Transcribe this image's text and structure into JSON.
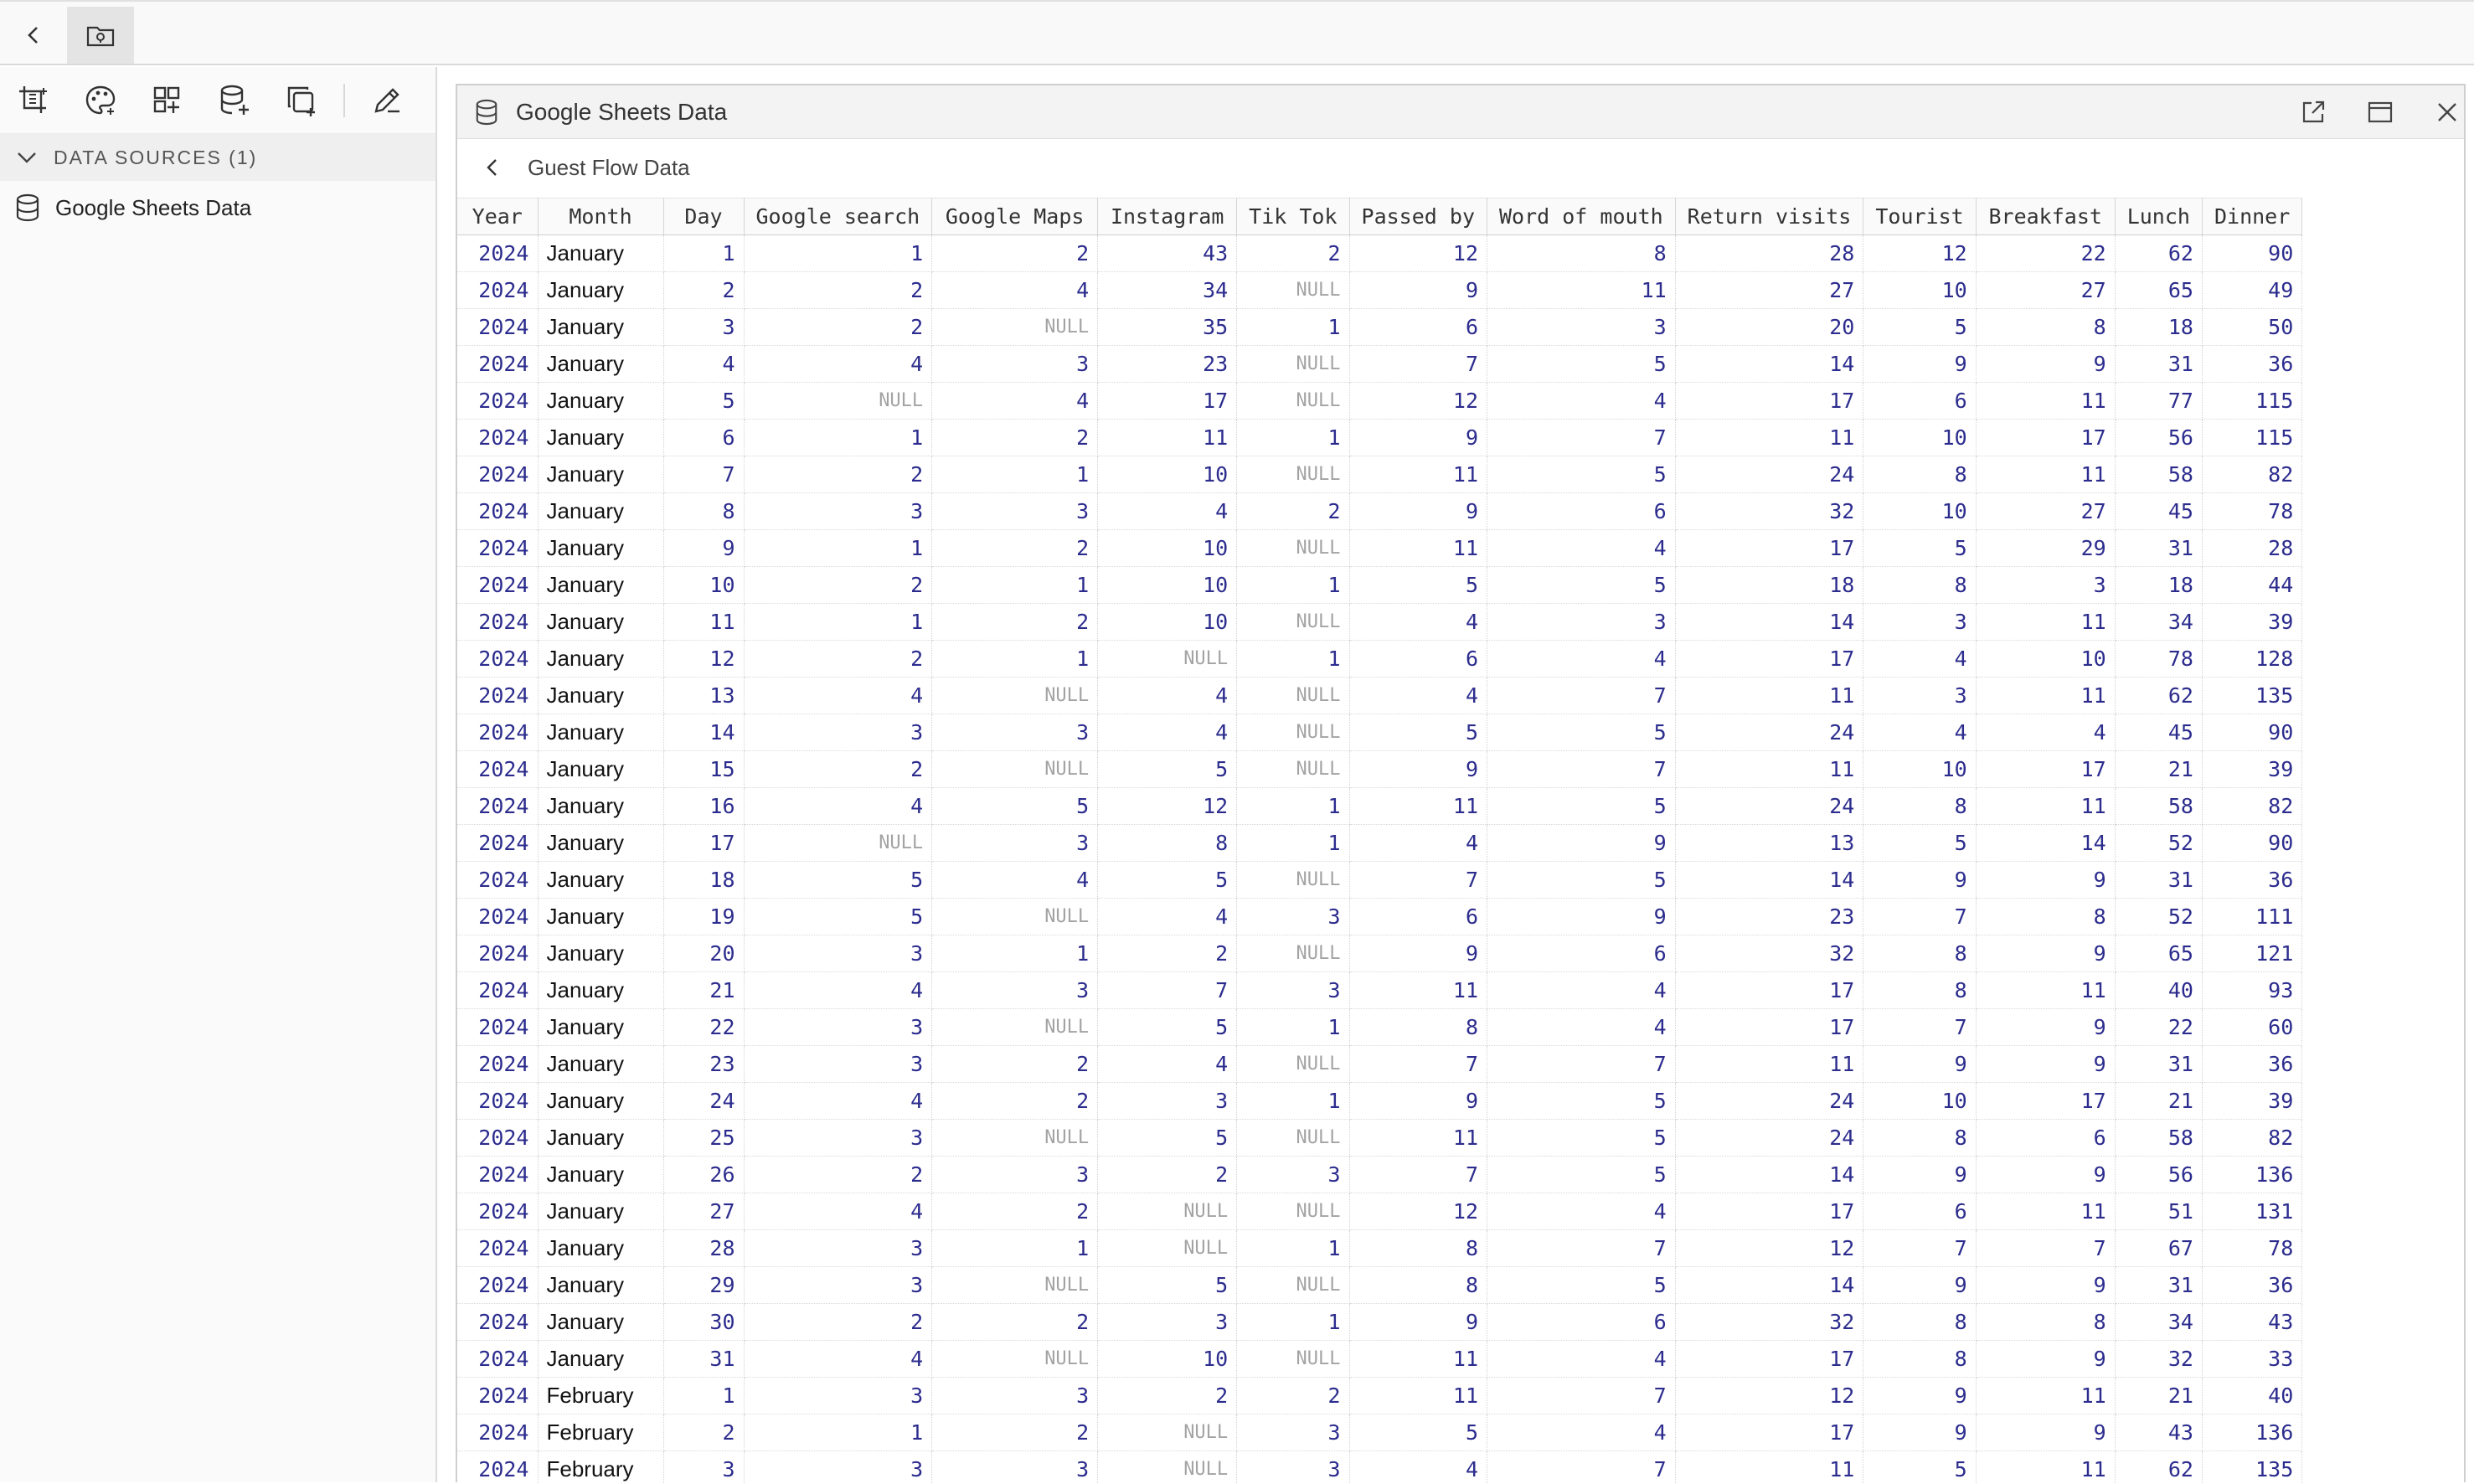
{
  "window": {
    "title": "Google Sheets Data",
    "breadcrumb": "Guest Flow Data"
  },
  "sidebar": {
    "section_title": "DATA SOURCES (1)",
    "items": [
      {
        "label": "Google Sheets Data",
        "icon": "database-icon"
      }
    ]
  },
  "table": {
    "columns": [
      "Year",
      "Month",
      "Day",
      "Google search",
      "Google Maps",
      "Instagram",
      "Tik Tok",
      "Passed by",
      "Word of mouth",
      "Return visits",
      "Tourist",
      "Breakfast",
      "Lunch",
      "Dinner"
    ],
    "null_text": "NULL",
    "rows": [
      [
        "2024",
        "January",
        "1",
        "1",
        "2",
        "43",
        "2",
        "12",
        "8",
        "28",
        "12",
        "22",
        "62",
        "90"
      ],
      [
        "2024",
        "January",
        "2",
        "2",
        "4",
        "34",
        "NULL",
        "9",
        "11",
        "27",
        "10",
        "27",
        "65",
        "49"
      ],
      [
        "2024",
        "January",
        "3",
        "2",
        "NULL",
        "35",
        "1",
        "6",
        "3",
        "20",
        "5",
        "8",
        "18",
        "50"
      ],
      [
        "2024",
        "January",
        "4",
        "4",
        "3",
        "23",
        "NULL",
        "7",
        "5",
        "14",
        "9",
        "9",
        "31",
        "36"
      ],
      [
        "2024",
        "January",
        "5",
        "NULL",
        "4",
        "17",
        "NULL",
        "12",
        "4",
        "17",
        "6",
        "11",
        "77",
        "115"
      ],
      [
        "2024",
        "January",
        "6",
        "1",
        "2",
        "11",
        "1",
        "9",
        "7",
        "11",
        "10",
        "17",
        "56",
        "115"
      ],
      [
        "2024",
        "January",
        "7",
        "2",
        "1",
        "10",
        "NULL",
        "11",
        "5",
        "24",
        "8",
        "11",
        "58",
        "82"
      ],
      [
        "2024",
        "January",
        "8",
        "3",
        "3",
        "4",
        "2",
        "9",
        "6",
        "32",
        "10",
        "27",
        "45",
        "78"
      ],
      [
        "2024",
        "January",
        "9",
        "1",
        "2",
        "10",
        "NULL",
        "11",
        "4",
        "17",
        "5",
        "29",
        "31",
        "28"
      ],
      [
        "2024",
        "January",
        "10",
        "2",
        "1",
        "10",
        "1",
        "5",
        "5",
        "18",
        "8",
        "3",
        "18",
        "44"
      ],
      [
        "2024",
        "January",
        "11",
        "1",
        "2",
        "10",
        "NULL",
        "4",
        "3",
        "14",
        "3",
        "11",
        "34",
        "39"
      ],
      [
        "2024",
        "January",
        "12",
        "2",
        "1",
        "NULL",
        "1",
        "6",
        "4",
        "17",
        "4",
        "10",
        "78",
        "128"
      ],
      [
        "2024",
        "January",
        "13",
        "4",
        "NULL",
        "4",
        "NULL",
        "4",
        "7",
        "11",
        "3",
        "11",
        "62",
        "135"
      ],
      [
        "2024",
        "January",
        "14",
        "3",
        "3",
        "4",
        "NULL",
        "5",
        "5",
        "24",
        "4",
        "4",
        "45",
        "90"
      ],
      [
        "2024",
        "January",
        "15",
        "2",
        "NULL",
        "5",
        "NULL",
        "9",
        "7",
        "11",
        "10",
        "17",
        "21",
        "39"
      ],
      [
        "2024",
        "January",
        "16",
        "4",
        "5",
        "12",
        "1",
        "11",
        "5",
        "24",
        "8",
        "11",
        "58",
        "82"
      ],
      [
        "2024",
        "January",
        "17",
        "NULL",
        "3",
        "8",
        "1",
        "4",
        "9",
        "13",
        "5",
        "14",
        "52",
        "90"
      ],
      [
        "2024",
        "January",
        "18",
        "5",
        "4",
        "5",
        "NULL",
        "7",
        "5",
        "14",
        "9",
        "9",
        "31",
        "36"
      ],
      [
        "2024",
        "January",
        "19",
        "5",
        "NULL",
        "4",
        "3",
        "6",
        "9",
        "23",
        "7",
        "8",
        "52",
        "111"
      ],
      [
        "2024",
        "January",
        "20",
        "3",
        "1",
        "2",
        "NULL",
        "9",
        "6",
        "32",
        "8",
        "9",
        "65",
        "121"
      ],
      [
        "2024",
        "January",
        "21",
        "4",
        "3",
        "7",
        "3",
        "11",
        "4",
        "17",
        "8",
        "11",
        "40",
        "93"
      ],
      [
        "2024",
        "January",
        "22",
        "3",
        "NULL",
        "5",
        "1",
        "8",
        "4",
        "17",
        "7",
        "9",
        "22",
        "60"
      ],
      [
        "2024",
        "January",
        "23",
        "3",
        "2",
        "4",
        "NULL",
        "7",
        "7",
        "11",
        "9",
        "9",
        "31",
        "36"
      ],
      [
        "2024",
        "January",
        "24",
        "4",
        "2",
        "3",
        "1",
        "9",
        "5",
        "24",
        "10",
        "17",
        "21",
        "39"
      ],
      [
        "2024",
        "January",
        "25",
        "3",
        "NULL",
        "5",
        "NULL",
        "11",
        "5",
        "24",
        "8",
        "6",
        "58",
        "82"
      ],
      [
        "2024",
        "January",
        "26",
        "2",
        "3",
        "2",
        "3",
        "7",
        "5",
        "14",
        "9",
        "9",
        "56",
        "136"
      ],
      [
        "2024",
        "January",
        "27",
        "4",
        "2",
        "NULL",
        "NULL",
        "12",
        "4",
        "17",
        "6",
        "11",
        "51",
        "131"
      ],
      [
        "2024",
        "January",
        "28",
        "3",
        "1",
        "NULL",
        "1",
        "8",
        "7",
        "12",
        "7",
        "7",
        "67",
        "78"
      ],
      [
        "2024",
        "January",
        "29",
        "3",
        "NULL",
        "5",
        "NULL",
        "8",
        "5",
        "14",
        "9",
        "9",
        "31",
        "36"
      ],
      [
        "2024",
        "January",
        "30",
        "2",
        "2",
        "3",
        "1",
        "9",
        "6",
        "32",
        "8",
        "8",
        "34",
        "43"
      ],
      [
        "2024",
        "January",
        "31",
        "4",
        "NULL",
        "10",
        "NULL",
        "11",
        "4",
        "17",
        "8",
        "9",
        "32",
        "33"
      ],
      [
        "2024",
        "February",
        "1",
        "3",
        "3",
        "2",
        "2",
        "11",
        "7",
        "12",
        "9",
        "11",
        "21",
        "40"
      ],
      [
        "2024",
        "February",
        "2",
        "1",
        "2",
        "NULL",
        "3",
        "5",
        "4",
        "17",
        "9",
        "9",
        "43",
        "136"
      ],
      [
        "2024",
        "February",
        "3",
        "3",
        "3",
        "NULL",
        "3",
        "4",
        "7",
        "11",
        "5",
        "11",
        "62",
        "135"
      ]
    ]
  }
}
